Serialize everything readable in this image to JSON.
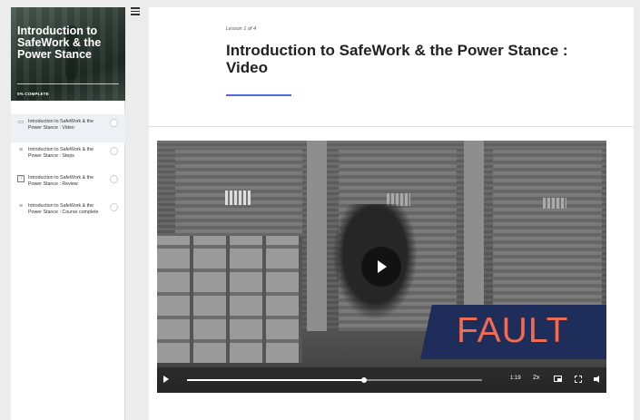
{
  "course": {
    "title": "Introduction to SafeWork & the Power Stance",
    "progress_label": "0% COMPLETE",
    "progress_percent": 0
  },
  "sidebar": {
    "menu_icon": "hamburger-menu-icon",
    "lessons": [
      {
        "label": "Introduction to SafeWork & the Power Stance : Video",
        "icon": "video-icon",
        "glyph": "▭",
        "active": true
      },
      {
        "label": "Introduction to SafeWork & the Power Stance : Steps",
        "icon": "text-lines-icon",
        "glyph": "≡",
        "active": false
      },
      {
        "label": "Introduction to SafeWork & the Power Stance : Review",
        "icon": "quiz-icon",
        "glyph": "?",
        "active": false
      },
      {
        "label": "Introduction to SafeWork & the Power Stance : Course complete",
        "icon": "text-lines-icon",
        "glyph": "≡",
        "active": false
      }
    ]
  },
  "lesson": {
    "count": "Lesson 1 of 4",
    "title": "Introduction to SafeWork & the Power Stance : Video",
    "accent_color": "#4f6ad0"
  },
  "video": {
    "overlay_text": "FAULT",
    "overlay_bg": "#1f2d5a",
    "overlay_color": "#ef6b52",
    "time": "1:19",
    "speed": "2x",
    "progress_fraction": 0.6
  }
}
